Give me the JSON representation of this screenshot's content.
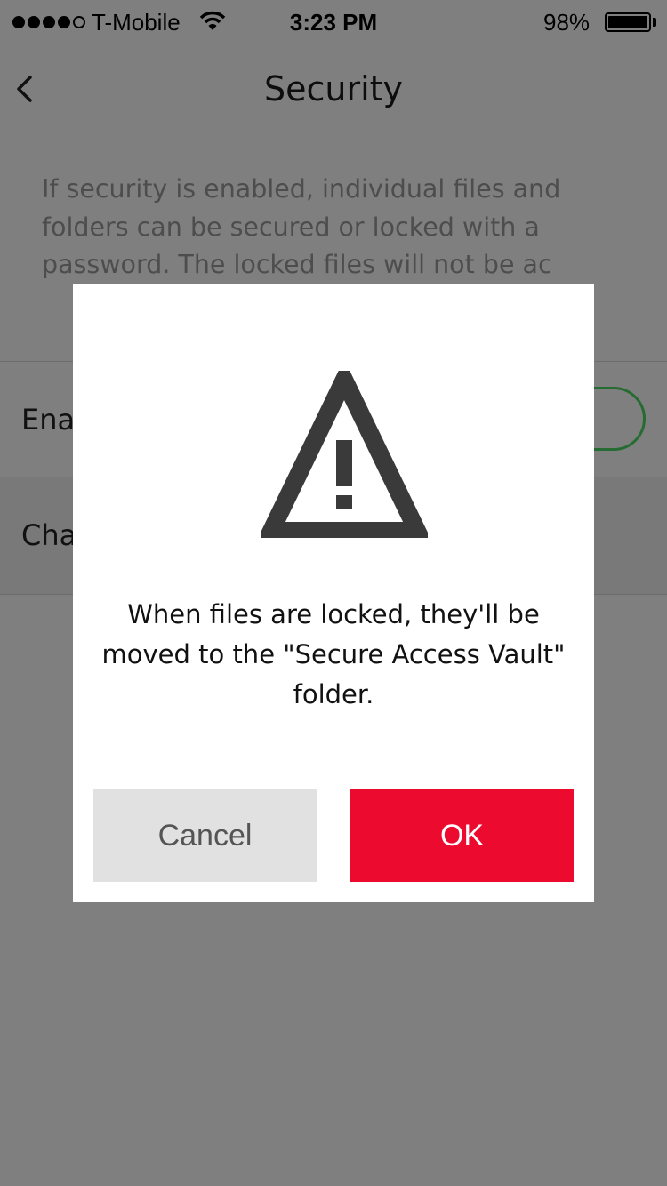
{
  "status_bar": {
    "carrier": "T-Mobile",
    "time": "3:23 PM",
    "battery": "98%",
    "signal_bars_filled": 4,
    "signal_bars_total": 5
  },
  "nav": {
    "title": "Security",
    "back_icon": "chevron-left-icon"
  },
  "content": {
    "description": "If security is enabled, individual files and folders can be secured or locked with a password. The locked files will not be ac",
    "enable_row_label": "Enal",
    "enable_toggle_on": true,
    "change_row_label": "Cha"
  },
  "dialog": {
    "icon": "warning-icon",
    "message": "When files are locked, they'll be moved to the \"Secure Access Vault\" folder.",
    "cancel_label": "Cancel",
    "ok_label": "OK"
  },
  "colors": {
    "accent_ok": "#ec0b2e",
    "toggle_on": "#4cd964",
    "cancel_bg": "#e1e1e1",
    "overlay": "rgba(0,0,0,0.5)"
  }
}
